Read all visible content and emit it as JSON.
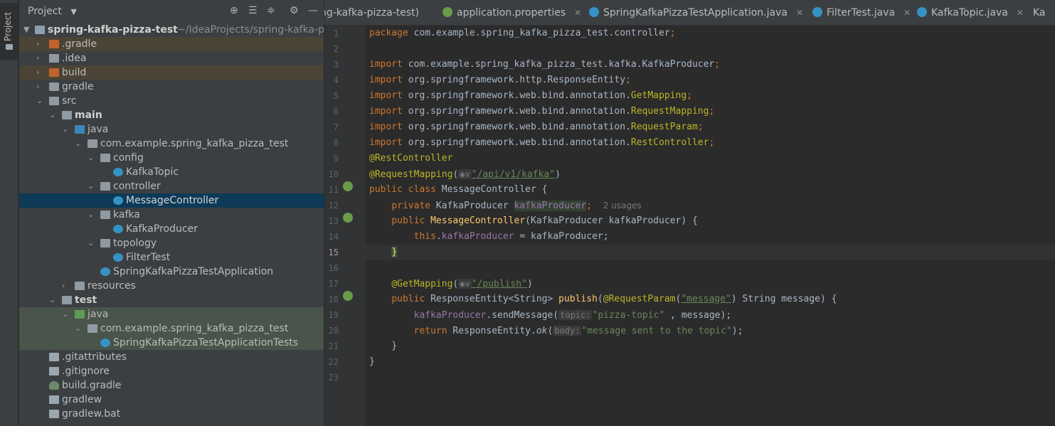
{
  "stripe": {
    "project_label": "Project"
  },
  "panel": {
    "title": "Project",
    "root": {
      "name": "spring-kafka-pizza-test",
      "path": "~/IdeaProjects/spring-kafka-p"
    },
    "items": [
      {
        "label": ".gradle"
      },
      {
        "label": ".idea"
      },
      {
        "label": "build"
      },
      {
        "label": "gradle"
      },
      {
        "label": "src"
      },
      {
        "label": "main"
      },
      {
        "label": "java"
      },
      {
        "label": "com.example.spring_kafka_pizza_test"
      },
      {
        "label": "config"
      },
      {
        "label": "KafkaTopic"
      },
      {
        "label": "controller"
      },
      {
        "label": "MessageController"
      },
      {
        "label": "kafka"
      },
      {
        "label": "KafkaProducer"
      },
      {
        "label": "topology"
      },
      {
        "label": "FilterTest"
      },
      {
        "label": "SpringKafkaPizzaTestApplication"
      },
      {
        "label": "resources"
      },
      {
        "label": "test"
      },
      {
        "label": "java"
      },
      {
        "label": "com.example.spring_kafka_pizza_test"
      },
      {
        "label": "SpringKafkaPizzaTestApplicationTests"
      },
      {
        "label": ".gitattributes"
      },
      {
        "label": ".gitignore"
      },
      {
        "label": "build.gradle"
      },
      {
        "label": "gradlew"
      },
      {
        "label": "gradlew.bat"
      }
    ]
  },
  "tabs": [
    {
      "label": "ng-kafka-pizza-test)"
    },
    {
      "label": "application.properties"
    },
    {
      "label": "SpringKafkaPizzaTestApplication.java"
    },
    {
      "label": "FilterTest.java"
    },
    {
      "label": "KafkaTopic.java"
    },
    {
      "label": "Ka"
    }
  ],
  "code": {
    "l1_kw": "package",
    "l1_rest": " com.example.spring_kafka_pizza_test.controller",
    "imports": [
      {
        "pkg": " com.example.spring_kafka_pizza_test.kafka.",
        "cls": "KafkaProducer"
      },
      {
        "pkg": " org.springframework.http.",
        "cls": "ResponseEntity"
      },
      {
        "pkg": " org.springframework.web.bind.annotation.",
        "cls": "GetMapping"
      },
      {
        "pkg": " org.springframework.web.bind.annotation.",
        "cls": "RequestMapping"
      },
      {
        "pkg": " org.springframework.web.bind.annotation.",
        "cls": "RequestParam"
      },
      {
        "pkg": " org.springframework.web.bind.annotation.",
        "cls": "RestController"
      }
    ],
    "import_kw": "import",
    "anno_rest": "@RestController",
    "anno_reqmap": "@RequestMapping",
    "reqmap_path": "\"/api/v1/kafka\"",
    "class_decl_kw": "public class",
    "class_name": " MessageController {",
    "field_kw": "private",
    "field_type": " KafkaProducer ",
    "field_name": "kafkaProducer",
    "usages": "2 usages",
    "ctor_kw": "public",
    "ctor_name": "MessageController",
    "ctor_params": "(KafkaProducer kafkaProducer) {",
    "this_kw": "this",
    "assign_rest": " = kafkaProducer;",
    "close_brace": "}",
    "anno_get": "@GetMapping",
    "get_path": "\"/publish\"",
    "method_kw": "public",
    "method_ret": " ResponseEntity<String> ",
    "method_name": "publish",
    "anno_param": "@RequestParam",
    "param_name": "\"message\"",
    "param_rest": ") String message) {",
    "send_field": "kafkaProducer",
    "send_call": ".sendMessage(",
    "hint_topic": "topic:",
    "send_topic": "\"pizza-topic\"",
    "send_rest": " , message);",
    "return_kw": "return",
    "return_cls": " ResponseEntity.",
    "ok_call": "ok",
    "hint_body": "body:",
    "return_str": "\"message sent to the topic\"",
    "return_end": ");"
  },
  "line_numbers": [
    "1",
    "2",
    "3",
    "4",
    "5",
    "6",
    "7",
    "8",
    "9",
    "10",
    "11",
    "12",
    "13",
    "14",
    "15",
    "16",
    "17",
    "18",
    "19",
    "20",
    "21",
    "22",
    "23"
  ]
}
